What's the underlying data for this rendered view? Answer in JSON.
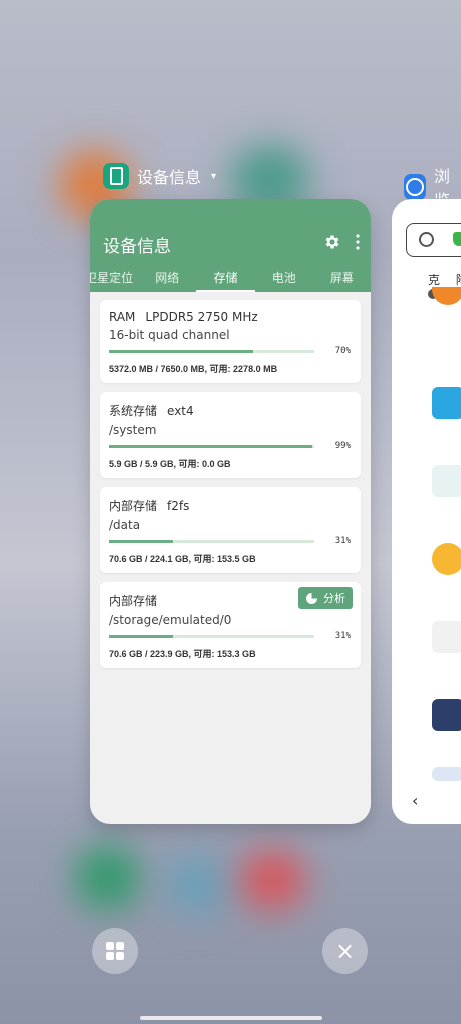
{
  "recents": {
    "current_app": {
      "name": "设备信息",
      "caret": "▾"
    },
    "next_app": {
      "name": "浏览"
    },
    "grid_button": "grid",
    "close_button": "×"
  },
  "app": {
    "title": "设备信息",
    "tabs": [
      "卫星定位",
      "网络",
      "存储",
      "电池",
      "屏幕"
    ],
    "active_tab": "存储"
  },
  "storage": [
    {
      "name": "RAM",
      "type": "LPDDR5 2750 MHz",
      "detail": "16-bit quad channel",
      "percent_label": "70%",
      "percent": 70,
      "stats": "5372.0 MB / 7650.0 MB, 可用: 2278.0 MB"
    },
    {
      "name": "系统存储",
      "type": "ext4",
      "detail": "/system",
      "percent_label": "99%",
      "percent": 99,
      "stats": "5.9 GB / 5.9 GB, 可用: 0.0 GB"
    },
    {
      "name": "内部存储",
      "type": "f2fs",
      "detail": "/data",
      "percent_label": "31%",
      "percent": 31,
      "stats": "70.6 GB / 224.1 GB, 可用: 153.5 GB"
    },
    {
      "name": "内部存储",
      "type": "",
      "detail": "/storage/emulated/0",
      "percent_label": "31%",
      "percent": 31,
      "stats": "70.6 GB / 223.9 GB, 可用: 153.3 GB",
      "action": "分析"
    }
  ],
  "browser": {
    "hotwords": "克 降",
    "back": "‹"
  },
  "colors": {
    "accent": "#5fa47a",
    "bar": "#6dad84"
  }
}
